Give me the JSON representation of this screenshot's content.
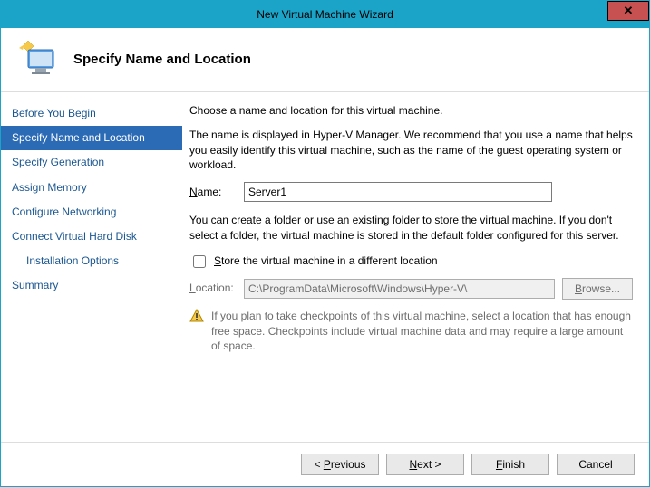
{
  "window": {
    "title": "New Virtual Machine Wizard"
  },
  "header": {
    "title": "Specify Name and Location"
  },
  "sidebar": {
    "items": [
      {
        "label": "Before You Begin"
      },
      {
        "label": "Specify Name and Location"
      },
      {
        "label": "Specify Generation"
      },
      {
        "label": "Assign Memory"
      },
      {
        "label": "Configure Networking"
      },
      {
        "label": "Connect Virtual Hard Disk"
      },
      {
        "label": "Installation Options"
      },
      {
        "label": "Summary"
      }
    ],
    "active_index": 1
  },
  "content": {
    "intro": "Choose a name and location for this virtual machine.",
    "nameHelp": "The name is displayed in Hyper-V Manager. We recommend that you use a name that helps you easily identify this virtual machine, such as the name of the guest operating system or workload.",
    "nameLabelPrefix": "N",
    "nameLabelRest": "ame:",
    "nameValue": "Server1",
    "locHelp": "You can create a folder or use an existing folder to store the virtual machine. If you don't select a folder, the virtual machine is stored in the default folder configured for this server.",
    "storeCheckboxPrefix": "S",
    "storeCheckboxRest": "tore the virtual machine in a different location",
    "storeChecked": false,
    "locationLabelPrefix": "L",
    "locationLabelRest": "ocation:",
    "locationValue": "C:\\ProgramData\\Microsoft\\Windows\\Hyper-V\\",
    "browsePrefix": "B",
    "browseRest": "rowse...",
    "infoText": "If you plan to take checkpoints of this virtual machine, select a location that has enough free space. Checkpoints include virtual machine data and may require a large amount of space."
  },
  "footer": {
    "prevPrefix": "P",
    "prevRest": "revious",
    "nextPrefix": "N",
    "nextRest": "ext",
    "finishPrefix": "F",
    "finishRest": "inish",
    "cancel": "Cancel"
  }
}
